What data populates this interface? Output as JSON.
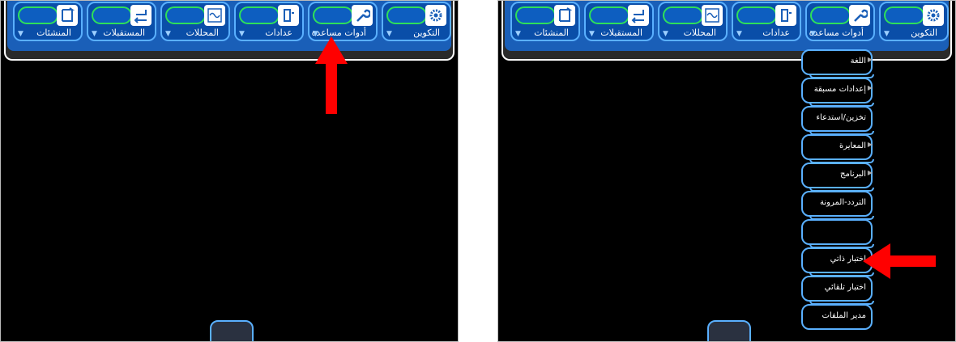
{
  "toolbar": {
    "buttons": [
      {
        "label": "التكوين",
        "icon": "gear-icon"
      },
      {
        "label": "أدوات مساعدة",
        "icon": "wrench-icon"
      },
      {
        "label": "عدادات",
        "icon": "meter-icon"
      },
      {
        "label": "المحللات",
        "icon": "waveform-icon"
      },
      {
        "label": "المستقبلات",
        "icon": "receiver-icon"
      },
      {
        "label": "المنشئات",
        "icon": "generator-icon"
      }
    ]
  },
  "menu": {
    "items": [
      {
        "label": "اللغة",
        "submenu": true
      },
      {
        "label": "إعدادات مسبقة",
        "submenu": true
      },
      {
        "label": "تخزين/استدعاء",
        "submenu": false
      },
      {
        "label": "المعايرة",
        "submenu": true
      },
      {
        "label": "البرنامج",
        "submenu": true
      },
      {
        "label": "التردد-المرونة",
        "submenu": false
      },
      {
        "label": "",
        "submenu": false
      },
      {
        "label": "اختبار ذاتي",
        "submenu": false
      },
      {
        "label": "اختبار تلقائي",
        "submenu": false
      },
      {
        "label": "مدير الملفات",
        "submenu": false
      }
    ]
  },
  "colors": {
    "toolbar": "#1a5fb8",
    "button_border": "#5ab0ff",
    "pill": "#2ee05a",
    "arrow": "#ff0000",
    "screen": "#000000"
  }
}
